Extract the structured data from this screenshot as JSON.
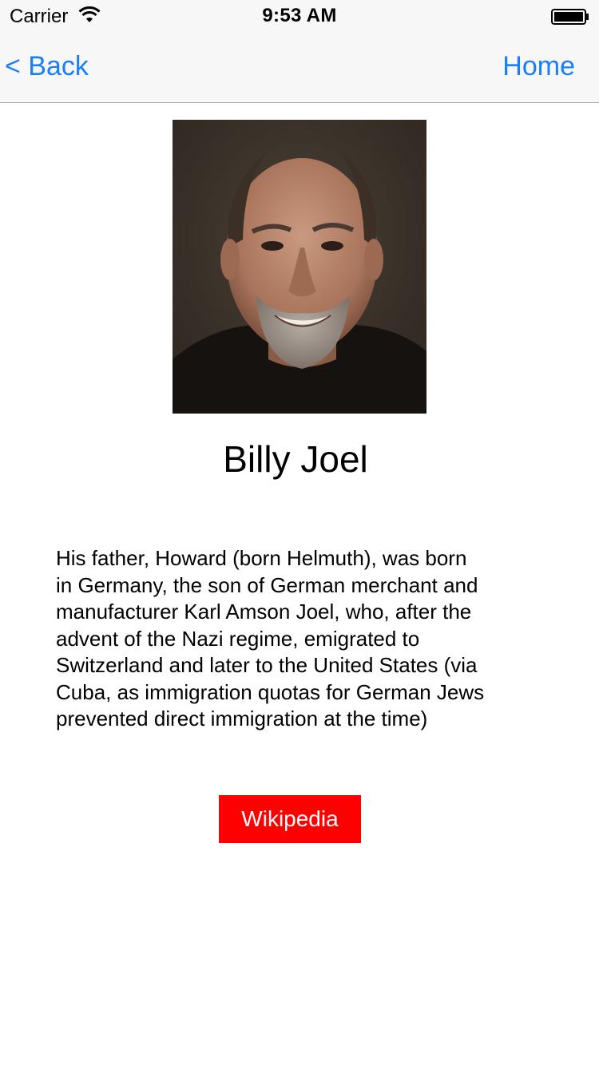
{
  "status_bar": {
    "carrier": "Carrier",
    "time": "9:53 AM",
    "wifi_icon": "wifi-icon",
    "battery_icon": "battery-icon"
  },
  "nav": {
    "back_label": "< Back",
    "home_label": "Home",
    "accent_color": "#1a7ef8"
  },
  "profile": {
    "image": "portrait-photo",
    "name": "Billy Joel",
    "bio_lines": [
      "His father, Howard (born Helmuth), was born",
      "in Germany, the son of German merchant and",
      "manufacturer Karl Amson Joel, who, after the",
      "advent of the Nazi regime, emigrated to",
      "Switzerland and later to the United States (via",
      "Cuba, as immigration quotas for German Jews",
      "prevented direct immigration at the time)"
    ]
  },
  "wiki_button": {
    "label": "Wikipedia",
    "color": "#ff0000"
  }
}
